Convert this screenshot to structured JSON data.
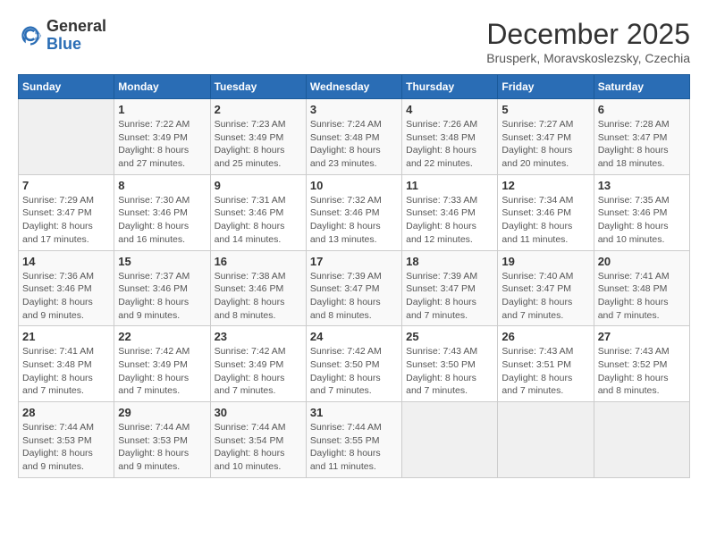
{
  "header": {
    "logo_general": "General",
    "logo_blue": "Blue",
    "month_title": "December 2025",
    "subtitle": "Brusperk, Moravskoslezsky, Czechia"
  },
  "weekdays": [
    "Sunday",
    "Monday",
    "Tuesday",
    "Wednesday",
    "Thursday",
    "Friday",
    "Saturday"
  ],
  "weeks": [
    [
      {
        "day": "",
        "info": ""
      },
      {
        "day": "1",
        "info": "Sunrise: 7:22 AM\nSunset: 3:49 PM\nDaylight: 8 hours and 27 minutes."
      },
      {
        "day": "2",
        "info": "Sunrise: 7:23 AM\nSunset: 3:49 PM\nDaylight: 8 hours and 25 minutes."
      },
      {
        "day": "3",
        "info": "Sunrise: 7:24 AM\nSunset: 3:48 PM\nDaylight: 8 hours and 23 minutes."
      },
      {
        "day": "4",
        "info": "Sunrise: 7:26 AM\nSunset: 3:48 PM\nDaylight: 8 hours and 22 minutes."
      },
      {
        "day": "5",
        "info": "Sunrise: 7:27 AM\nSunset: 3:47 PM\nDaylight: 8 hours and 20 minutes."
      },
      {
        "day": "6",
        "info": "Sunrise: 7:28 AM\nSunset: 3:47 PM\nDaylight: 8 hours and 18 minutes."
      }
    ],
    [
      {
        "day": "7",
        "info": "Sunrise: 7:29 AM\nSunset: 3:47 PM\nDaylight: 8 hours and 17 minutes."
      },
      {
        "day": "8",
        "info": "Sunrise: 7:30 AM\nSunset: 3:46 PM\nDaylight: 8 hours and 16 minutes."
      },
      {
        "day": "9",
        "info": "Sunrise: 7:31 AM\nSunset: 3:46 PM\nDaylight: 8 hours and 14 minutes."
      },
      {
        "day": "10",
        "info": "Sunrise: 7:32 AM\nSunset: 3:46 PM\nDaylight: 8 hours and 13 minutes."
      },
      {
        "day": "11",
        "info": "Sunrise: 7:33 AM\nSunset: 3:46 PM\nDaylight: 8 hours and 12 minutes."
      },
      {
        "day": "12",
        "info": "Sunrise: 7:34 AM\nSunset: 3:46 PM\nDaylight: 8 hours and 11 minutes."
      },
      {
        "day": "13",
        "info": "Sunrise: 7:35 AM\nSunset: 3:46 PM\nDaylight: 8 hours and 10 minutes."
      }
    ],
    [
      {
        "day": "14",
        "info": "Sunrise: 7:36 AM\nSunset: 3:46 PM\nDaylight: 8 hours and 9 minutes."
      },
      {
        "day": "15",
        "info": "Sunrise: 7:37 AM\nSunset: 3:46 PM\nDaylight: 8 hours and 9 minutes."
      },
      {
        "day": "16",
        "info": "Sunrise: 7:38 AM\nSunset: 3:46 PM\nDaylight: 8 hours and 8 minutes."
      },
      {
        "day": "17",
        "info": "Sunrise: 7:39 AM\nSunset: 3:47 PM\nDaylight: 8 hours and 8 minutes."
      },
      {
        "day": "18",
        "info": "Sunrise: 7:39 AM\nSunset: 3:47 PM\nDaylight: 8 hours and 7 minutes."
      },
      {
        "day": "19",
        "info": "Sunrise: 7:40 AM\nSunset: 3:47 PM\nDaylight: 8 hours and 7 minutes."
      },
      {
        "day": "20",
        "info": "Sunrise: 7:41 AM\nSunset: 3:48 PM\nDaylight: 8 hours and 7 minutes."
      }
    ],
    [
      {
        "day": "21",
        "info": "Sunrise: 7:41 AM\nSunset: 3:48 PM\nDaylight: 8 hours and 7 minutes."
      },
      {
        "day": "22",
        "info": "Sunrise: 7:42 AM\nSunset: 3:49 PM\nDaylight: 8 hours and 7 minutes."
      },
      {
        "day": "23",
        "info": "Sunrise: 7:42 AM\nSunset: 3:49 PM\nDaylight: 8 hours and 7 minutes."
      },
      {
        "day": "24",
        "info": "Sunrise: 7:42 AM\nSunset: 3:50 PM\nDaylight: 8 hours and 7 minutes."
      },
      {
        "day": "25",
        "info": "Sunrise: 7:43 AM\nSunset: 3:50 PM\nDaylight: 8 hours and 7 minutes."
      },
      {
        "day": "26",
        "info": "Sunrise: 7:43 AM\nSunset: 3:51 PM\nDaylight: 8 hours and 7 minutes."
      },
      {
        "day": "27",
        "info": "Sunrise: 7:43 AM\nSunset: 3:52 PM\nDaylight: 8 hours and 8 minutes."
      }
    ],
    [
      {
        "day": "28",
        "info": "Sunrise: 7:44 AM\nSunset: 3:53 PM\nDaylight: 8 hours and 9 minutes."
      },
      {
        "day": "29",
        "info": "Sunrise: 7:44 AM\nSunset: 3:53 PM\nDaylight: 8 hours and 9 minutes."
      },
      {
        "day": "30",
        "info": "Sunrise: 7:44 AM\nSunset: 3:54 PM\nDaylight: 8 hours and 10 minutes."
      },
      {
        "day": "31",
        "info": "Sunrise: 7:44 AM\nSunset: 3:55 PM\nDaylight: 8 hours and 11 minutes."
      },
      {
        "day": "",
        "info": ""
      },
      {
        "day": "",
        "info": ""
      },
      {
        "day": "",
        "info": ""
      }
    ]
  ]
}
